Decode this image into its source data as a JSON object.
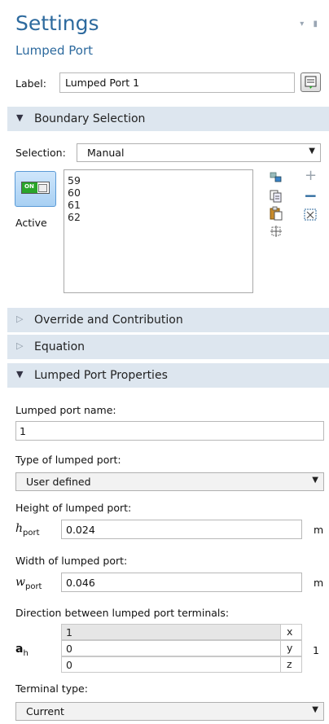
{
  "header": {
    "title": "Settings",
    "subtitle": "Lumped Port"
  },
  "label_row": {
    "label": "Label:",
    "value": "Lumped Port 1"
  },
  "boundary_selection": {
    "section_title": "Boundary Selection",
    "selection_label": "Selection:",
    "selection_value": "Manual",
    "toggle_text": "ON",
    "active_label": "Active",
    "items": [
      "59",
      "60",
      "61",
      "62"
    ]
  },
  "collapsed_sections": [
    "Override and Contribution",
    "Equation"
  ],
  "properties": {
    "section_title": "Lumped Port Properties",
    "name_label": "Lumped port name:",
    "name_value": "1",
    "type_label": "Type of lumped port:",
    "type_value": "User defined",
    "height_label": "Height of lumped port:",
    "height_symbol": "h",
    "height_sub": "port",
    "height_value": "0.024",
    "height_unit": "m",
    "width_label": "Width of lumped port:",
    "width_symbol": "w",
    "width_sub": "port",
    "width_value": "0.046",
    "width_unit": "m",
    "direction_label": "Direction between lumped port terminals:",
    "direction_symbol": "a",
    "direction_sub": "h",
    "direction_values": [
      "1",
      "0",
      "0"
    ],
    "direction_axes": [
      "x",
      "y",
      "z"
    ],
    "direction_unit": "1",
    "terminal_label": "Terminal type:",
    "terminal_value": "Current"
  },
  "colors": {
    "accent": "#2d6a9e",
    "section_bg": "#dde6ef",
    "toggle_green": "#2aa52a"
  }
}
